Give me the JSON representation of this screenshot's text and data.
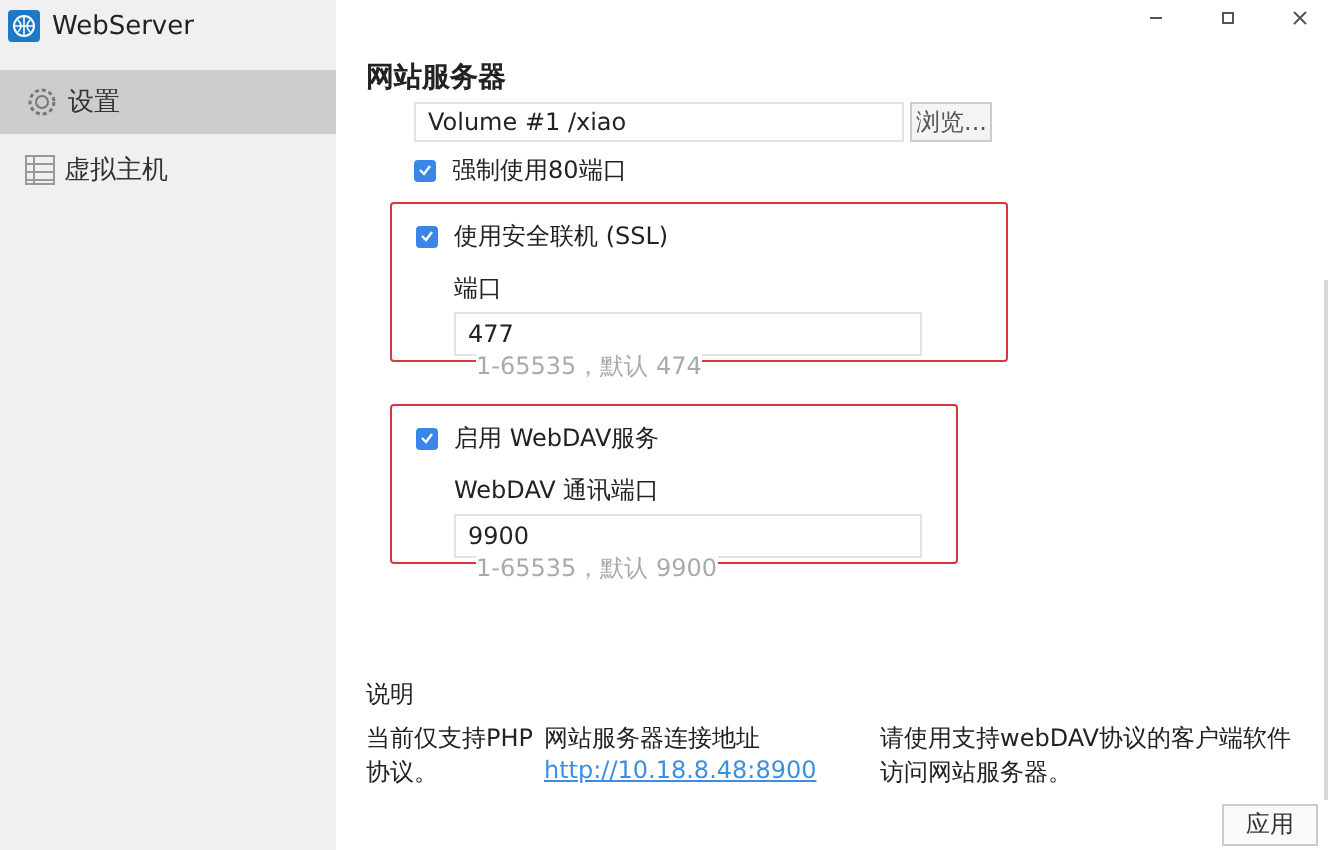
{
  "window": {
    "title": "WebServer"
  },
  "sidebar": {
    "items": [
      {
        "label": "设置",
        "selected": true,
        "kind": "gear"
      },
      {
        "label": "虚拟主机",
        "selected": false,
        "kind": "list"
      }
    ]
  },
  "heading": "网站服务器",
  "path_field": {
    "value": "Volume #1 /xiao",
    "button": "浏览..."
  },
  "force_port_80": {
    "label": "强制使用80端口",
    "checked": true
  },
  "sections": [
    {
      "label": "使用安全联机 (SSL)",
      "checked": true,
      "highlighted": true,
      "field_label": "端口",
      "value": "477",
      "hint": "1-65535，默认 474"
    },
    {
      "label": "启用 WebDAV服务",
      "checked": true,
      "highlighted": true,
      "field_label": "WebDAV 通讯端口",
      "value": "9900",
      "hint": "1-65535，默认 9900"
    }
  ],
  "notes": {
    "title": "说明",
    "columns": [
      {
        "text": "当前仅支持PHP协议。"
      },
      {
        "text": "网站服务器连接地址",
        "link": "http://10.18.8.48:8900"
      },
      {
        "text": "请使用支持webDAV协议的客户端软件访问网站服务器。"
      }
    ]
  },
  "apply_button": "应用"
}
